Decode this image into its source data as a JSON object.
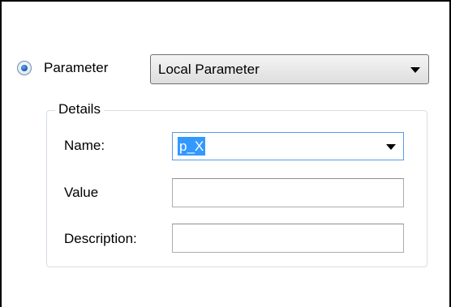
{
  "parameter_option": {
    "label": "Parameter",
    "selected": true
  },
  "parameter_type": {
    "selected_value": "Local Parameter"
  },
  "details": {
    "title": "Details",
    "name": {
      "label": "Name:",
      "value": "p_X"
    },
    "value_field": {
      "label": "Value",
      "value": ""
    },
    "description": {
      "label": "Description:",
      "value": ""
    }
  },
  "colors": {
    "selection": "#3399ff",
    "focus_border": "#569de5",
    "group_border": "#d5dfe5"
  }
}
